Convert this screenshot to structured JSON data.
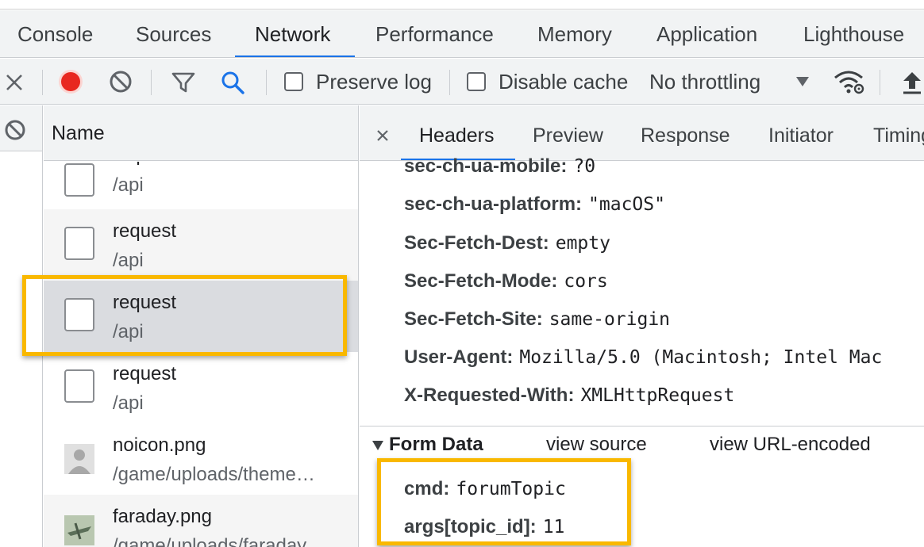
{
  "tabs": [
    "Console",
    "Sources",
    "Network",
    "Performance",
    "Memory",
    "Application",
    "Lighthouse"
  ],
  "toolbar": {
    "preserve_log": "Preserve log",
    "disable_cache": "Disable cache",
    "throttling": "No throttling",
    "record_color": "#e8271f",
    "search_color": "#1a73e8"
  },
  "name_column": {
    "header": "Name",
    "rows": [
      {
        "name": "request",
        "path": "/api"
      },
      {
        "name": "request",
        "path": "/api"
      },
      {
        "name": "request",
        "path": "/api"
      },
      {
        "name": "request",
        "path": "/api"
      },
      {
        "name": "noicon.png",
        "path": "/game/uploads/theme…"
      },
      {
        "name": "faraday.png",
        "path": "/game/uploads/faraday…"
      }
    ]
  },
  "detail_tabs": [
    "Headers",
    "Preview",
    "Response",
    "Initiator",
    "Timing"
  ],
  "headers": [
    {
      "key": "sec-ch-ua-mobile:",
      "value": "?0"
    },
    {
      "key": "sec-ch-ua-platform:",
      "value": "\"macOS\""
    },
    {
      "key": "Sec-Fetch-Dest:",
      "value": "empty"
    },
    {
      "key": "Sec-Fetch-Mode:",
      "value": "cors"
    },
    {
      "key": "Sec-Fetch-Site:",
      "value": "same-origin"
    },
    {
      "key": "User-Agent:",
      "value": "Mozilla/5.0 (Macintosh; Intel Mac"
    },
    {
      "key": "X-Requested-With:",
      "value": "XMLHttpRequest"
    }
  ],
  "form_data": {
    "title": "Form Data",
    "view_source": "view source",
    "view_url_encoded": "view URL-encoded",
    "fields": [
      {
        "key": "cmd:",
        "value": "forumTopic"
      },
      {
        "key": "args[topic_id]:",
        "value": "11"
      }
    ]
  },
  "highlight_color": "#f9b800"
}
